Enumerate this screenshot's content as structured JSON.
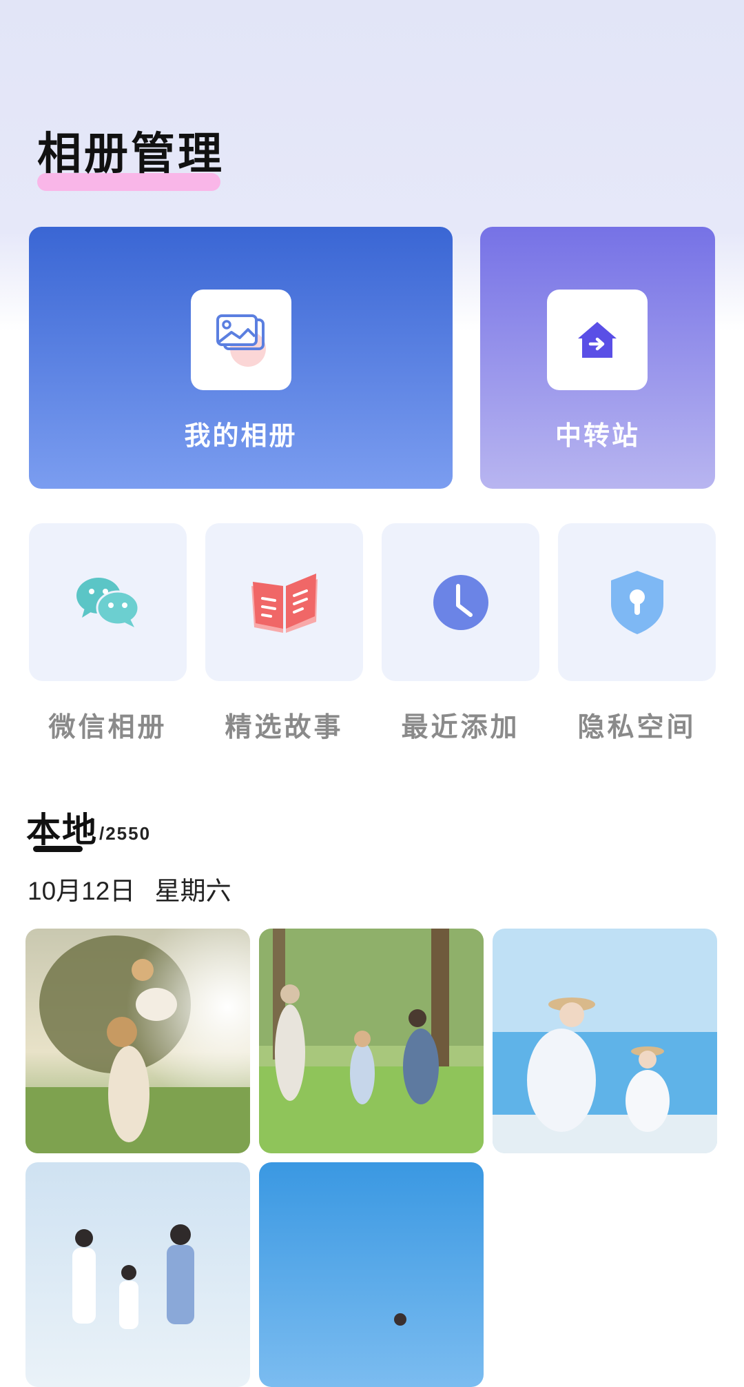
{
  "header": {
    "title": "相册管理"
  },
  "main_cards": [
    {
      "label": "我的相册",
      "icon": "photo-album-icon"
    },
    {
      "label": "中转站",
      "icon": "transit-house-icon"
    }
  ],
  "quick_links": [
    {
      "label": "微信相册",
      "icon": "wechat-icon"
    },
    {
      "label": "精选故事",
      "icon": "book-icon"
    },
    {
      "label": "最近添加",
      "icon": "clock-icon"
    },
    {
      "label": "隐私空间",
      "icon": "shield-lock-icon"
    }
  ],
  "local": {
    "title": "本地",
    "count": "/2550",
    "date": "10月12日",
    "weekday": "星期六"
  },
  "colors": {
    "album_card": "#3a66d4",
    "transit_card": "#7672e6",
    "tile_bg": "#eef2fc",
    "title_highlight": "#f9b6e8"
  }
}
